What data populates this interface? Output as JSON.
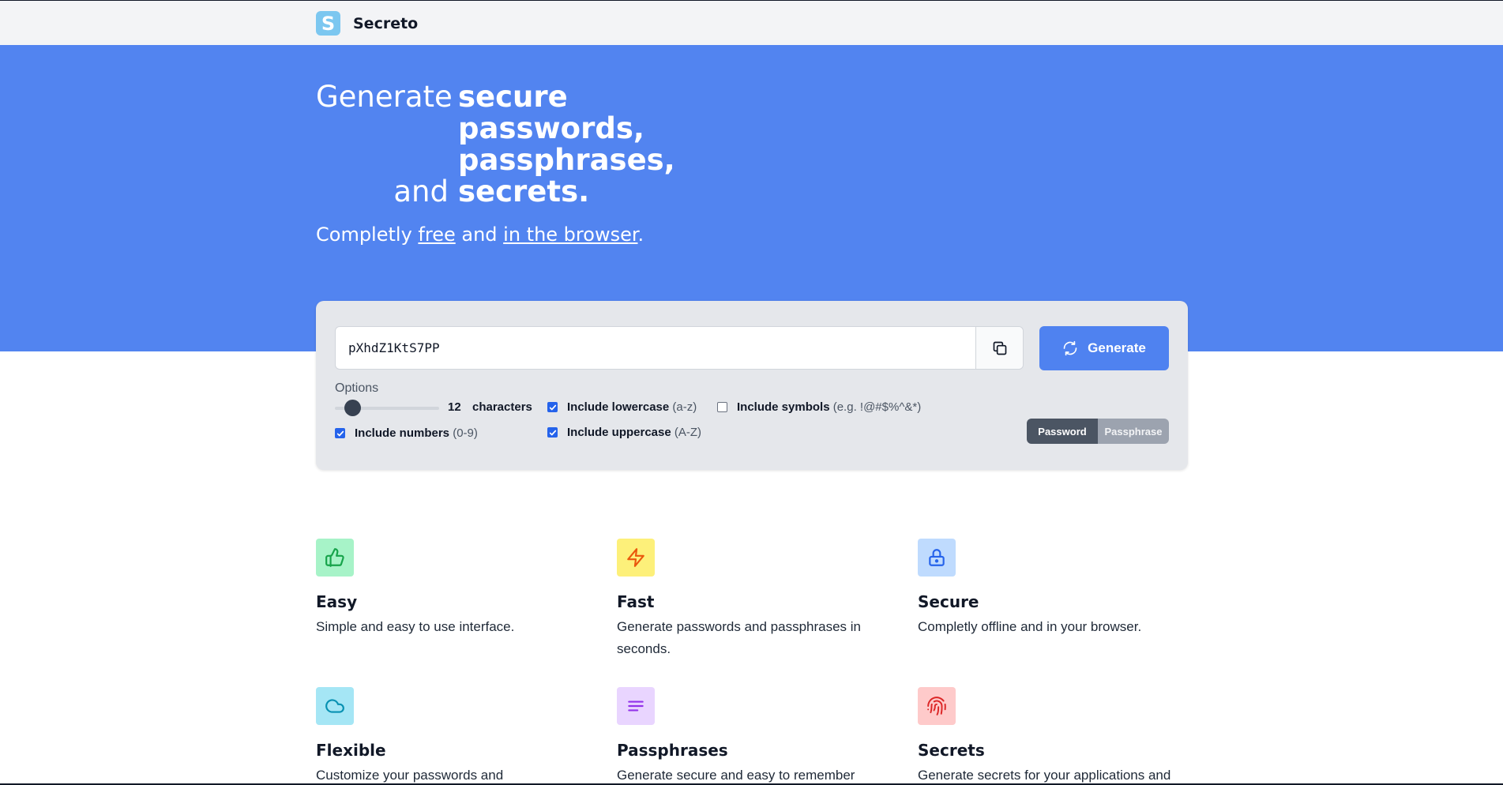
{
  "header": {
    "logo_letter": "S",
    "app_name": "Secreto"
  },
  "hero": {
    "headline": {
      "prefix": "Generate",
      "lines": [
        "secure",
        "passwords,",
        "passphrases,",
        "secrets."
      ],
      "suffix_prefix": "and"
    },
    "subline": {
      "part1": "Completly ",
      "link1": "free",
      "part2": " and ",
      "link2": "in the browser",
      "part3": "."
    }
  },
  "generator": {
    "password_value": "pXhdZ1KtS7PP",
    "generate_label": "Generate",
    "options_label": "Options",
    "length": 12,
    "length_min": 8,
    "length_max": 64,
    "characters_label": "characters",
    "checkboxes": [
      {
        "label": "Include lowercase",
        "hint": "(a-z)",
        "checked": true
      },
      {
        "label": "Include symbols",
        "hint": "(e.g. !@#$%^&*)",
        "checked": false
      },
      {
        "label": "Include numbers",
        "hint": "(0-9)",
        "checked": true
      },
      {
        "label": "Include uppercase",
        "hint": "(A-Z)",
        "checked": true
      }
    ],
    "modes": [
      "Password",
      "Passphrase"
    ],
    "active_mode": "Password"
  },
  "features": [
    {
      "title": "Easy",
      "desc": "Simple and easy to use interface.",
      "icon": "thumbs-up-icon",
      "bg": "#a7f3c8",
      "fg": "#16a34a"
    },
    {
      "title": "Fast",
      "desc": "Generate passwords and passphrases in seconds.",
      "icon": "lightning-icon",
      "bg": "#fdf07a",
      "fg": "#ea580c"
    },
    {
      "title": "Secure",
      "desc": "Completly offline and in your browser.",
      "icon": "lock-icon",
      "bg": "#bfdbfe",
      "fg": "#2563eb"
    },
    {
      "title": "Flexible",
      "desc": "Customize your passwords and",
      "icon": "cloud-icon",
      "bg": "#a5e6f5",
      "fg": "#0891b2"
    },
    {
      "title": "Passphrases",
      "desc": "Generate secure and easy to remember",
      "icon": "text-lines-icon",
      "bg": "#e9d5ff",
      "fg": "#9333ea"
    },
    {
      "title": "Secrets",
      "desc": "Generate secrets for your applications and",
      "icon": "fingerprint-icon",
      "bg": "#fecaca",
      "fg": "#dc2626"
    }
  ]
}
